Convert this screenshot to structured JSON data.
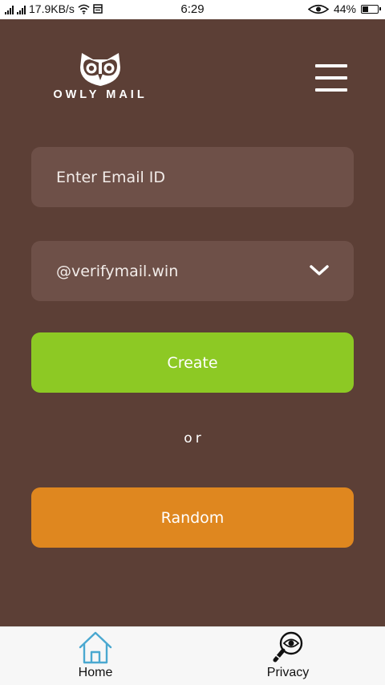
{
  "status_bar": {
    "network_speed": "17.9KB/s",
    "time": "6:29",
    "battery_percent": "44%",
    "battery_level": 0.44
  },
  "header": {
    "logo_text": "OWLY MAIL",
    "menu_icon": "hamburger-menu-icon"
  },
  "form": {
    "email_placeholder": "Enter Email ID",
    "email_value": "",
    "domain_selected": "@verifymail.win",
    "create_label": "Create",
    "or_label": "or",
    "random_label": "Random"
  },
  "bottom_nav": {
    "items": [
      {
        "label": "Home",
        "icon": "home-icon"
      },
      {
        "label": "Privacy",
        "icon": "privacy-eye-magnifier-icon"
      }
    ]
  },
  "colors": {
    "background": "#5c3f36",
    "field": "#6e5048",
    "create": "#8dc924",
    "random": "#df871f",
    "home_icon": "#4aa8d0"
  }
}
